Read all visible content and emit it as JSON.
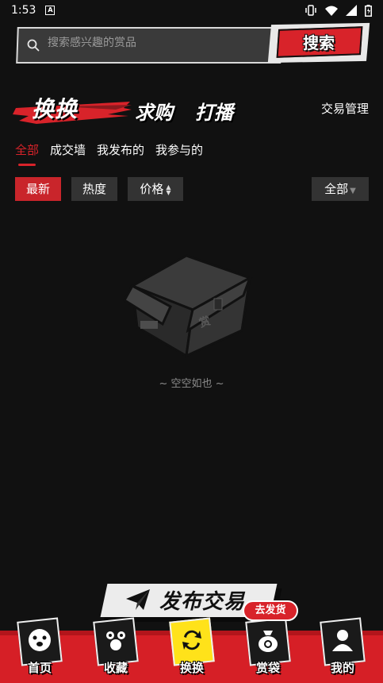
{
  "status_bar": {
    "time": "1:53",
    "app_letter": "A"
  },
  "search": {
    "placeholder": "搜索感兴趣的赏品",
    "button_label": "搜索"
  },
  "header": {
    "tabs": [
      {
        "label": "换换",
        "active": true
      },
      {
        "label": "求购",
        "active": false
      },
      {
        "label": "打播",
        "active": false
      }
    ],
    "trade_management": "交易管理"
  },
  "filters": {
    "tabs": [
      {
        "label": "全部",
        "active": true
      },
      {
        "label": "成交墙",
        "active": false
      },
      {
        "label": "我发布的",
        "active": false
      },
      {
        "label": "我参与的",
        "active": false
      }
    ]
  },
  "sort": {
    "options": [
      {
        "label": "最新",
        "active": true
      },
      {
        "label": "热度",
        "active": false
      },
      {
        "label": "价格",
        "active": false
      }
    ],
    "category_select": "全部"
  },
  "empty_state": {
    "text": "~ 空空如也 ~"
  },
  "publish": {
    "label": "发布交易"
  },
  "bottom_nav": {
    "items": [
      {
        "label": "首页",
        "icon": "dog-face-icon",
        "active": false
      },
      {
        "label": "收藏",
        "icon": "paw-icon",
        "active": false
      },
      {
        "label": "换换",
        "icon": "swap-icon",
        "active": true
      },
      {
        "label": "赏袋",
        "icon": "money-bag-icon",
        "active": false
      },
      {
        "label": "我的",
        "icon": "user-icon",
        "active": false
      }
    ],
    "badge": "去发货"
  },
  "colors": {
    "accent": "#d8232a",
    "background": "#111111",
    "active_nav": "#ffe21a"
  }
}
